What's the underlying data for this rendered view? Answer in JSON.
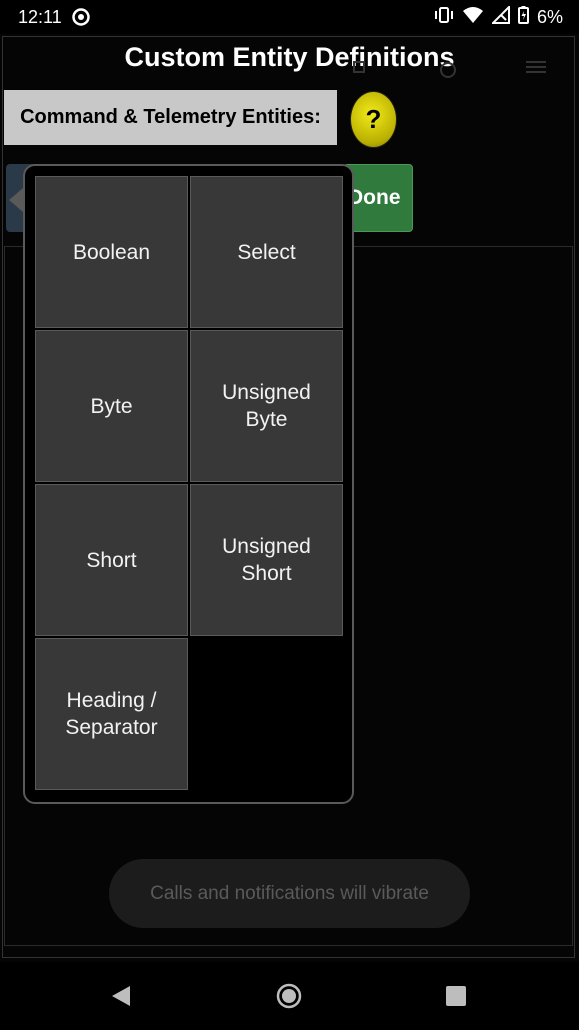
{
  "status_bar": {
    "time": "12:11",
    "battery_percent": "6%",
    "icons": [
      "do-not-disturb-icon",
      "vibrate-icon",
      "wifi-icon",
      "signal-icon",
      "battery-icon"
    ]
  },
  "header": {
    "title": "Custom Entity Definitions"
  },
  "section": {
    "label": "Command & Telemetry Entities:",
    "help_label": "?",
    "done_label": "Done"
  },
  "popup": {
    "items": [
      {
        "label": "Boolean"
      },
      {
        "label": "Select"
      },
      {
        "label": "Byte"
      },
      {
        "label": "Unsigned\nByte"
      },
      {
        "label": "Short"
      },
      {
        "label": "Unsigned\nShort"
      },
      {
        "label": "Heading /\nSeparator"
      }
    ]
  },
  "toast": {
    "text": "Calls and notifications will vibrate"
  },
  "nav": {
    "icons": [
      "back-icon",
      "home-icon",
      "recents-icon"
    ]
  },
  "colors": {
    "help_yellow": "#e6dc10",
    "done_green": "#2f7a3c",
    "label_gray": "#c8c8c8",
    "cell_gray": "#383838"
  }
}
